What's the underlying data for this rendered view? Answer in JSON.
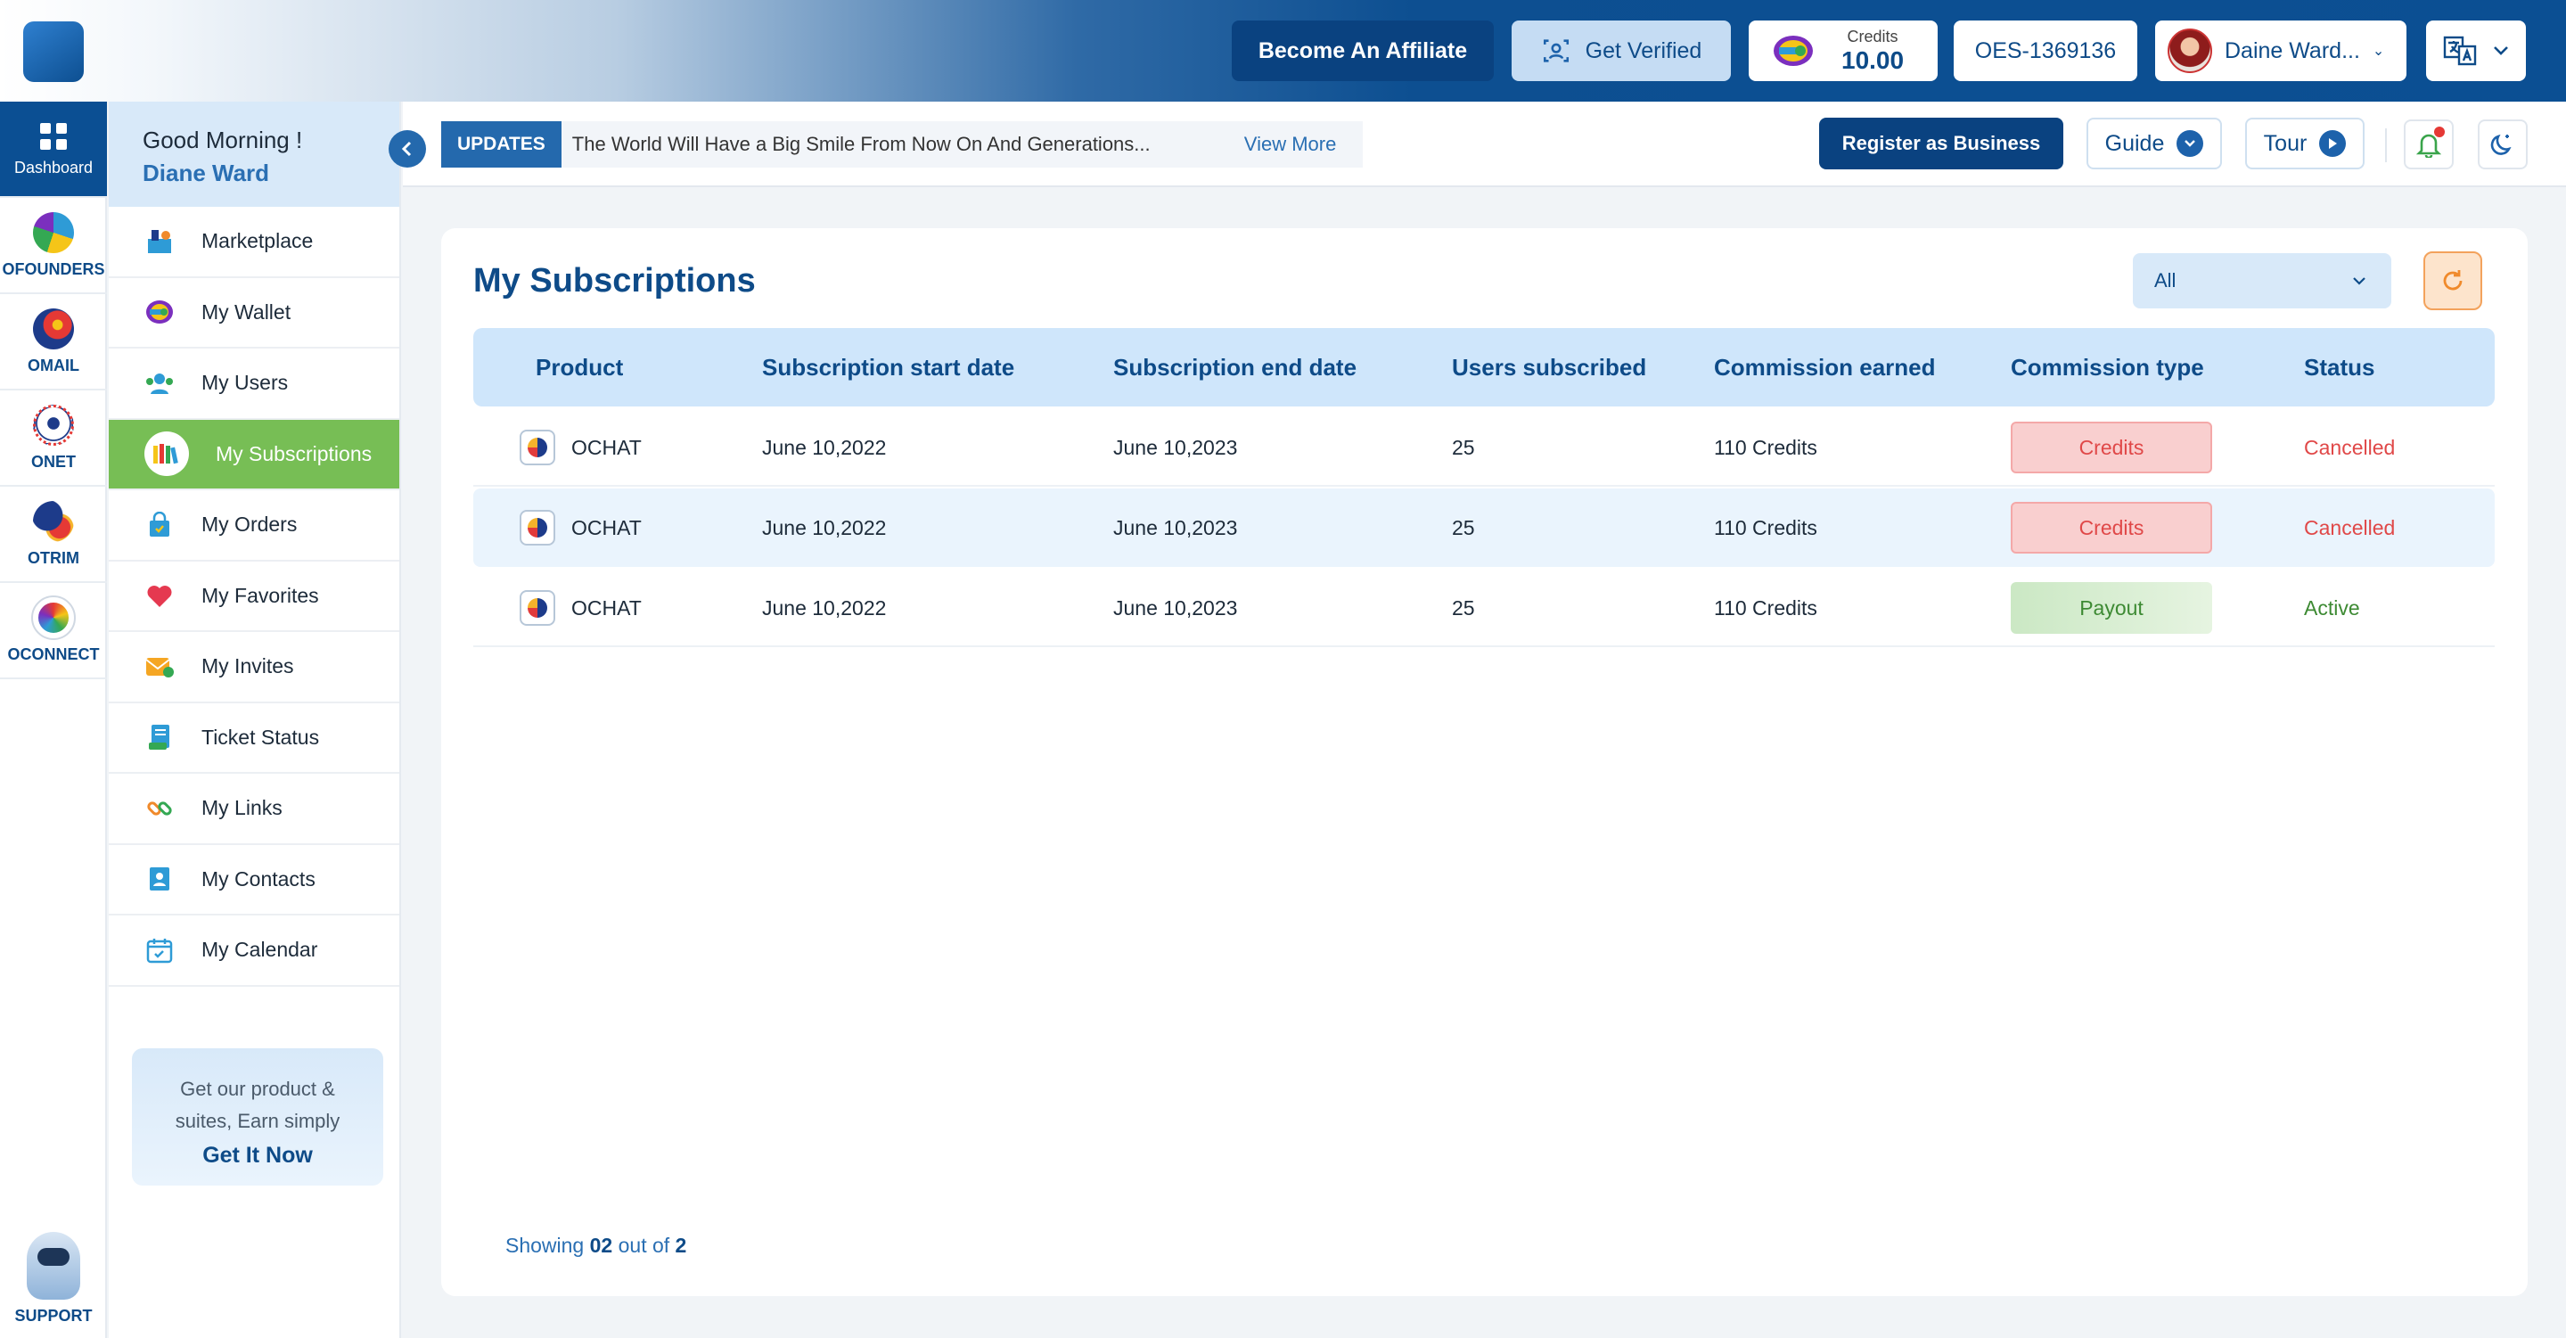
{
  "header": {
    "affiliate_label": "Become An Affiliate",
    "verified_label": "Get Verified",
    "credits_label": "Credits",
    "credits_value": "10.00",
    "account_id": "OES-1369136",
    "user_name": "Daine Ward...",
    "accent_color": "#0b4f93"
  },
  "rail": {
    "items": [
      {
        "label": "Dashboard",
        "icon": "grid-icon"
      },
      {
        "label": "OFOUNDERS",
        "icon": "ofounders-icon"
      },
      {
        "label": "OMAIL",
        "icon": "omail-icon"
      },
      {
        "label": "ONET",
        "icon": "onet-icon"
      },
      {
        "label": "OTRIM",
        "icon": "otrim-icon"
      },
      {
        "label": "OCONNECT",
        "icon": "oconnect-icon"
      }
    ],
    "support_label": "SUPPORT"
  },
  "sidebar": {
    "greeting": "Good Morning !",
    "user": "Diane Ward",
    "items": [
      {
        "label": "Marketplace",
        "icon": "marketplace-icon"
      },
      {
        "label": "My Wallet",
        "icon": "wallet-icon"
      },
      {
        "label": "My Users",
        "icon": "users-icon"
      },
      {
        "label": "My Subscriptions",
        "icon": "subscriptions-icon"
      },
      {
        "label": "My Orders",
        "icon": "orders-icon"
      },
      {
        "label": "My Favorites",
        "icon": "heart-icon"
      },
      {
        "label": "My Invites",
        "icon": "invites-icon"
      },
      {
        "label": "Ticket Status",
        "icon": "ticket-icon"
      },
      {
        "label": "My Links",
        "icon": "links-icon"
      },
      {
        "label": "My Contacts",
        "icon": "contacts-icon"
      },
      {
        "label": "My Calendar",
        "icon": "calendar-icon"
      }
    ],
    "promo_text": "Get our product & suites, Earn simply",
    "promo_cta": "Get It Now"
  },
  "subbar": {
    "updates_tag": "UPDATES",
    "updates_text": "The World Will Have a Big Smile From Now On And Generations...",
    "updates_link": "View More",
    "register_label": "Register as Business",
    "guide_label": "Guide",
    "tour_label": "Tour"
  },
  "main": {
    "title": "My Subscriptions",
    "filter_value": "All",
    "columns": [
      "Product",
      "Subscription start date",
      "Subscription end date",
      "Users subscribed",
      "Commission earned",
      "Commission type",
      "Status"
    ],
    "rows": [
      {
        "product": "OCHAT",
        "start": "June 10,2022",
        "end": "June 10,2023",
        "users": "25",
        "commission": "110 Credits",
        "type": "Credits",
        "status": "Cancelled"
      },
      {
        "product": "OCHAT",
        "start": "June 10,2022",
        "end": "June 10,2023",
        "users": "25",
        "commission": "110 Credits",
        "type": "Credits",
        "status": "Cancelled"
      },
      {
        "product": "OCHAT",
        "start": "June 10,2022",
        "end": "June 10,2023",
        "users": "25",
        "commission": "110 Credits",
        "type": "Payout",
        "status": "Active"
      }
    ],
    "showing_prefix": "Showing",
    "showing_count": "02",
    "showing_mid": "out of",
    "showing_total": "2"
  }
}
